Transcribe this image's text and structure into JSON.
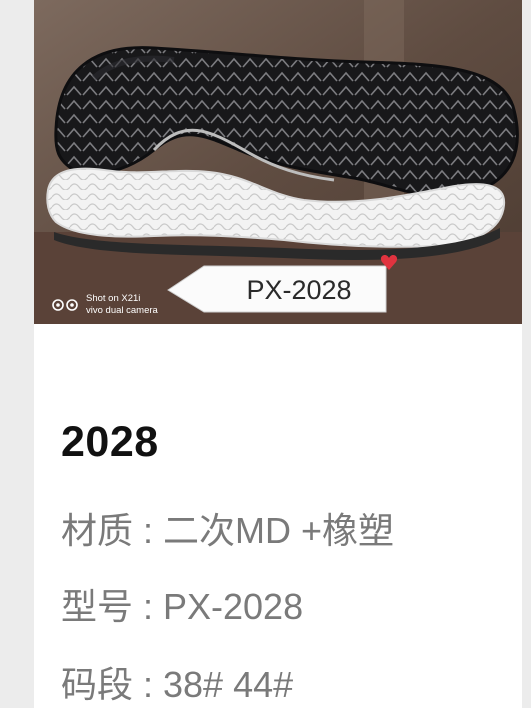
{
  "photo": {
    "sole_tag": "PX-2028",
    "watermark_line1": "Shot on X21i",
    "watermark_line2": "vivo dual camera",
    "colors": {
      "background_wall": "#6b5649",
      "sole_black": "#1d1d1f",
      "sole_white": "#f4f4f4",
      "tag_paper": "#fbfbfb"
    }
  },
  "product": {
    "name": "2028",
    "material": "材质 : 二次MD +橡塑",
    "model": "型号 : PX-2028",
    "size_range": "码段 : 38# 44#"
  }
}
